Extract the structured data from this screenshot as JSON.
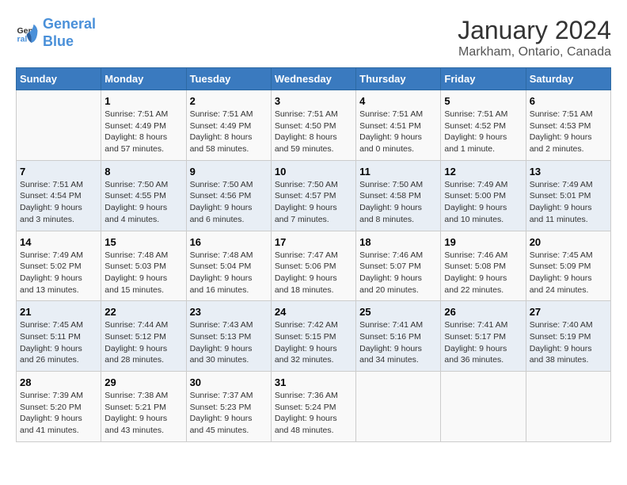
{
  "logo": {
    "line1": "General",
    "line2": "Blue"
  },
  "title": "January 2024",
  "subtitle": "Markham, Ontario, Canada",
  "days_of_week": [
    "Sunday",
    "Monday",
    "Tuesday",
    "Wednesday",
    "Thursday",
    "Friday",
    "Saturday"
  ],
  "weeks": [
    [
      {
        "day": "",
        "info": ""
      },
      {
        "day": "1",
        "info": "Sunrise: 7:51 AM\nSunset: 4:49 PM\nDaylight: 8 hours\nand 57 minutes."
      },
      {
        "day": "2",
        "info": "Sunrise: 7:51 AM\nSunset: 4:49 PM\nDaylight: 8 hours\nand 58 minutes."
      },
      {
        "day": "3",
        "info": "Sunrise: 7:51 AM\nSunset: 4:50 PM\nDaylight: 8 hours\nand 59 minutes."
      },
      {
        "day": "4",
        "info": "Sunrise: 7:51 AM\nSunset: 4:51 PM\nDaylight: 9 hours\nand 0 minutes."
      },
      {
        "day": "5",
        "info": "Sunrise: 7:51 AM\nSunset: 4:52 PM\nDaylight: 9 hours\nand 1 minute."
      },
      {
        "day": "6",
        "info": "Sunrise: 7:51 AM\nSunset: 4:53 PM\nDaylight: 9 hours\nand 2 minutes."
      }
    ],
    [
      {
        "day": "7",
        "info": "Sunrise: 7:51 AM\nSunset: 4:54 PM\nDaylight: 9 hours\nand 3 minutes."
      },
      {
        "day": "8",
        "info": "Sunrise: 7:50 AM\nSunset: 4:55 PM\nDaylight: 9 hours\nand 4 minutes."
      },
      {
        "day": "9",
        "info": "Sunrise: 7:50 AM\nSunset: 4:56 PM\nDaylight: 9 hours\nand 6 minutes."
      },
      {
        "day": "10",
        "info": "Sunrise: 7:50 AM\nSunset: 4:57 PM\nDaylight: 9 hours\nand 7 minutes."
      },
      {
        "day": "11",
        "info": "Sunrise: 7:50 AM\nSunset: 4:58 PM\nDaylight: 9 hours\nand 8 minutes."
      },
      {
        "day": "12",
        "info": "Sunrise: 7:49 AM\nSunset: 5:00 PM\nDaylight: 9 hours\nand 10 minutes."
      },
      {
        "day": "13",
        "info": "Sunrise: 7:49 AM\nSunset: 5:01 PM\nDaylight: 9 hours\nand 11 minutes."
      }
    ],
    [
      {
        "day": "14",
        "info": "Sunrise: 7:49 AM\nSunset: 5:02 PM\nDaylight: 9 hours\nand 13 minutes."
      },
      {
        "day": "15",
        "info": "Sunrise: 7:48 AM\nSunset: 5:03 PM\nDaylight: 9 hours\nand 15 minutes."
      },
      {
        "day": "16",
        "info": "Sunrise: 7:48 AM\nSunset: 5:04 PM\nDaylight: 9 hours\nand 16 minutes."
      },
      {
        "day": "17",
        "info": "Sunrise: 7:47 AM\nSunset: 5:06 PM\nDaylight: 9 hours\nand 18 minutes."
      },
      {
        "day": "18",
        "info": "Sunrise: 7:46 AM\nSunset: 5:07 PM\nDaylight: 9 hours\nand 20 minutes."
      },
      {
        "day": "19",
        "info": "Sunrise: 7:46 AM\nSunset: 5:08 PM\nDaylight: 9 hours\nand 22 minutes."
      },
      {
        "day": "20",
        "info": "Sunrise: 7:45 AM\nSunset: 5:09 PM\nDaylight: 9 hours\nand 24 minutes."
      }
    ],
    [
      {
        "day": "21",
        "info": "Sunrise: 7:45 AM\nSunset: 5:11 PM\nDaylight: 9 hours\nand 26 minutes."
      },
      {
        "day": "22",
        "info": "Sunrise: 7:44 AM\nSunset: 5:12 PM\nDaylight: 9 hours\nand 28 minutes."
      },
      {
        "day": "23",
        "info": "Sunrise: 7:43 AM\nSunset: 5:13 PM\nDaylight: 9 hours\nand 30 minutes."
      },
      {
        "day": "24",
        "info": "Sunrise: 7:42 AM\nSunset: 5:15 PM\nDaylight: 9 hours\nand 32 minutes."
      },
      {
        "day": "25",
        "info": "Sunrise: 7:41 AM\nSunset: 5:16 PM\nDaylight: 9 hours\nand 34 minutes."
      },
      {
        "day": "26",
        "info": "Sunrise: 7:41 AM\nSunset: 5:17 PM\nDaylight: 9 hours\nand 36 minutes."
      },
      {
        "day": "27",
        "info": "Sunrise: 7:40 AM\nSunset: 5:19 PM\nDaylight: 9 hours\nand 38 minutes."
      }
    ],
    [
      {
        "day": "28",
        "info": "Sunrise: 7:39 AM\nSunset: 5:20 PM\nDaylight: 9 hours\nand 41 minutes."
      },
      {
        "day": "29",
        "info": "Sunrise: 7:38 AM\nSunset: 5:21 PM\nDaylight: 9 hours\nand 43 minutes."
      },
      {
        "day": "30",
        "info": "Sunrise: 7:37 AM\nSunset: 5:23 PM\nDaylight: 9 hours\nand 45 minutes."
      },
      {
        "day": "31",
        "info": "Sunrise: 7:36 AM\nSunset: 5:24 PM\nDaylight: 9 hours\nand 48 minutes."
      },
      {
        "day": "",
        "info": ""
      },
      {
        "day": "",
        "info": ""
      },
      {
        "day": "",
        "info": ""
      }
    ]
  ]
}
